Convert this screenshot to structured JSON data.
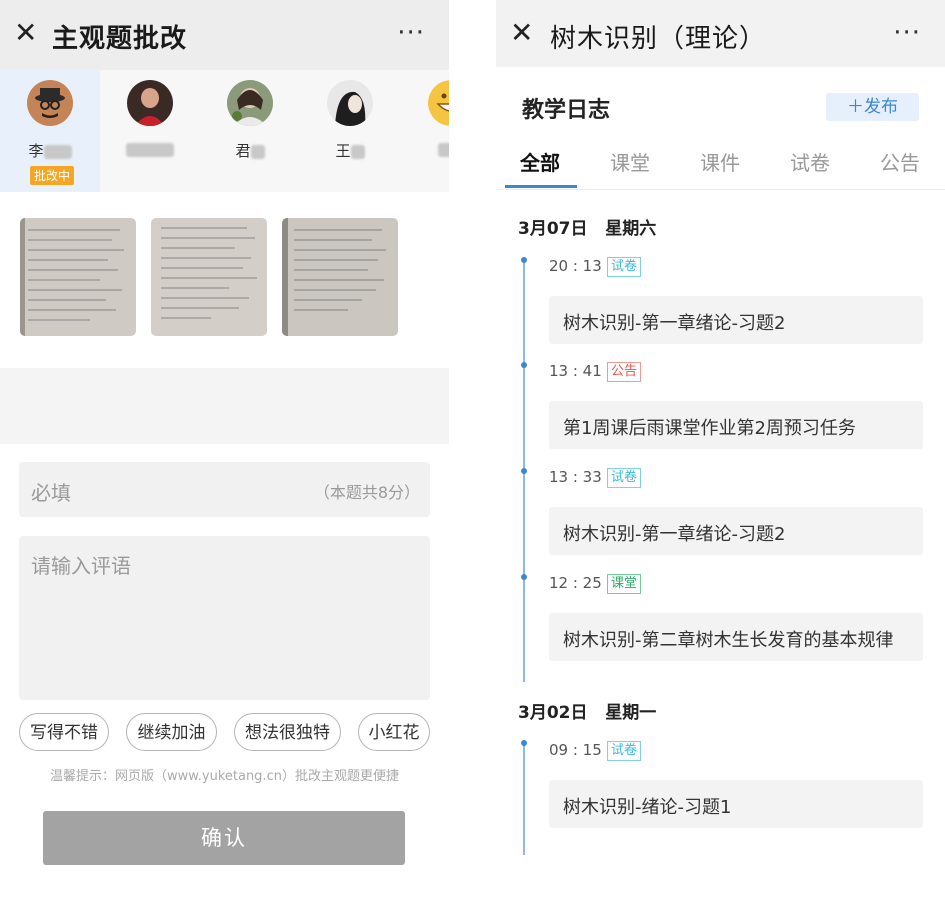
{
  "left": {
    "title": "主观题批改",
    "more": "···",
    "students": [
      {
        "name": "李",
        "status": "批改中"
      },
      {
        "name": ""
      },
      {
        "name": "君"
      },
      {
        "name": "王"
      },
      {
        "name": ""
      }
    ],
    "score": {
      "placeholder": "必填",
      "hint": "（本题共8分）"
    },
    "comment": {
      "placeholder": "请输入评语"
    },
    "quick_comments": [
      "写得不错",
      "继续加油",
      "想法很独特",
      "小红花"
    ],
    "tip": "温馨提示：网页版（www.yuketang.cn）批改主观题更便捷",
    "confirm": "确认"
  },
  "right": {
    "title": "树木识别（理论）",
    "more": "···",
    "header": "教学日志",
    "publish": "＋发布",
    "tabs": [
      "全部",
      "课堂",
      "课件",
      "试卷",
      "公告"
    ],
    "groups": [
      {
        "date": "3月07日",
        "weekday": "星期六",
        "entries": [
          {
            "time": "20 : 13",
            "tag": "试卷",
            "title": "树木识别-第一章绪论-习题2"
          },
          {
            "time": "13 : 41",
            "tag": "公告",
            "title": "第1周课后雨课堂作业第2周预习任务"
          },
          {
            "time": "13 : 33",
            "tag": "试卷",
            "title": "树木识别-第一章绪论-习题2"
          },
          {
            "time": "12 : 25",
            "tag": "课堂",
            "title": "树木识别-第二章树木生长发育的基本规律"
          }
        ]
      },
      {
        "date": "3月02日",
        "weekday": "星期一",
        "entries": [
          {
            "time": "09 : 15",
            "tag": "试卷",
            "title": "树木识别-绪论-习题1"
          }
        ]
      }
    ]
  }
}
